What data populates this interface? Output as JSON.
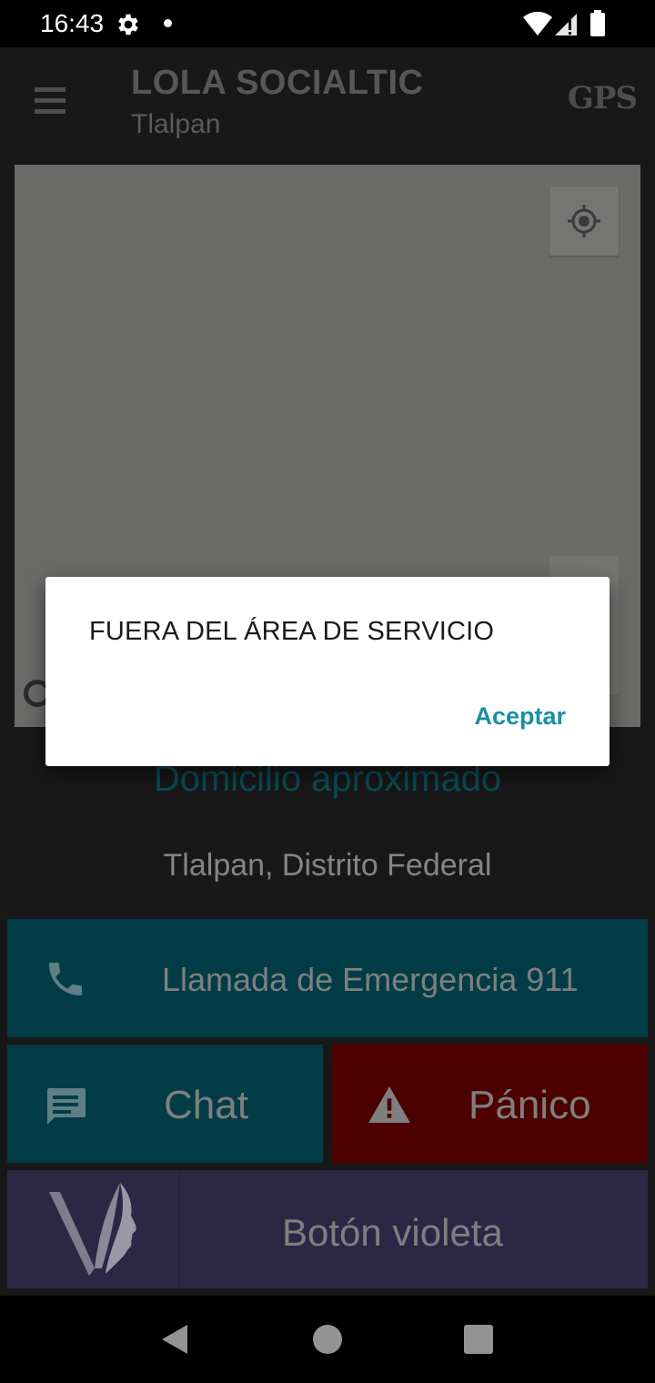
{
  "status_bar": {
    "time": "16:43"
  },
  "app_bar": {
    "title": "LOLA SOCIALTIC",
    "subtitle": "Tlalpan",
    "gps_label": "GPS"
  },
  "address": {
    "heading": "Domicilio aproximado",
    "value": "Tlalpan, Distrito Federal"
  },
  "actions": {
    "emergency_label": "Llamada de Emergencia 911",
    "chat_label": "Chat",
    "panic_label": "Pánico",
    "violet_label": "Botón violeta"
  },
  "dialog": {
    "message": "FUERA DEL ÁREA DE SERVICIO",
    "accept_label": "Aceptar"
  },
  "colors": {
    "teal_button": "#023c47",
    "panic_button": "#4d0000",
    "violet_button": "#2c2744",
    "accent": "#1a8fa3"
  },
  "icons": {
    "menu": "hamburger-icon",
    "locate": "my-location-icon",
    "phone": "phone-icon",
    "chat": "chat-bubble-icon",
    "warning": "warning-icon",
    "violet_logo": "violet-face-logo"
  }
}
